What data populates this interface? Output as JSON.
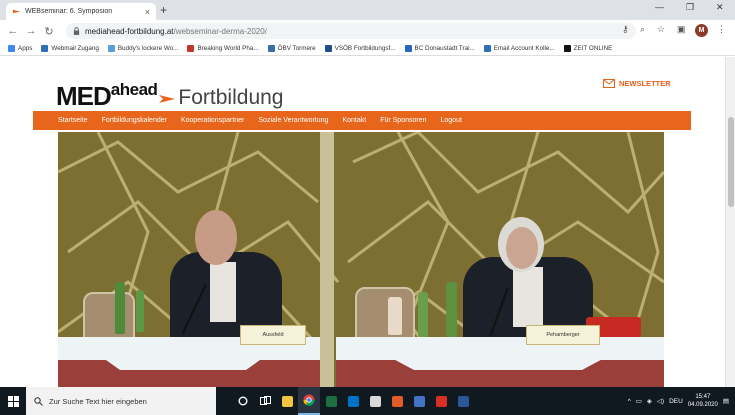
{
  "browser": {
    "tab_title": "WEBseminar: 6. Symposion",
    "url_host": "mediahead-fortbildung.at",
    "url_path": "/webseminar-derma-2020/"
  },
  "bookmarks": [
    {
      "label": "Apps",
      "color": "#4285f4"
    },
    {
      "label": "Webmail Zugang",
      "color": "#2b6fb6"
    },
    {
      "label": "Buddy's lockere Wo...",
      "color": "#5aa0d8"
    },
    {
      "label": "Breaking World Pha...",
      "color": "#c0392b"
    },
    {
      "label": "ÖBV Tormere",
      "color": "#3a6ea5"
    },
    {
      "label": "VSÖB Fortbildungsf...",
      "color": "#1f4e8c"
    },
    {
      "label": "BC Donaustadt Trai...",
      "color": "#2a64c4"
    },
    {
      "label": "Email Account Kolle...",
      "color": "#2b6fb6"
    },
    {
      "label": "ZEIT ONLINE",
      "color": "#111111"
    }
  ],
  "site": {
    "logo_med": "MED",
    "logo_ahead": "ahead",
    "logo_fortbildung": "Fortbildung",
    "newsletter_label": "NEWSLETTER",
    "nav": [
      "Startseite",
      "Fortbildungskalender",
      "Kooperationspartner",
      "Soziale Verantwortung",
      "Kontakt",
      "Für Sponsoren",
      "Logout"
    ]
  },
  "video": {
    "nameplate_left": "Aussfeld",
    "nameplate_right": "Pehamberger"
  },
  "taskbar": {
    "search_placeholder": "Zur Suche Text hier eingeben",
    "language": "DEU",
    "time": "15:47",
    "date": "04.09.2020"
  },
  "colors": {
    "brand_orange": "#e8661b",
    "taskbar": "#101820"
  }
}
